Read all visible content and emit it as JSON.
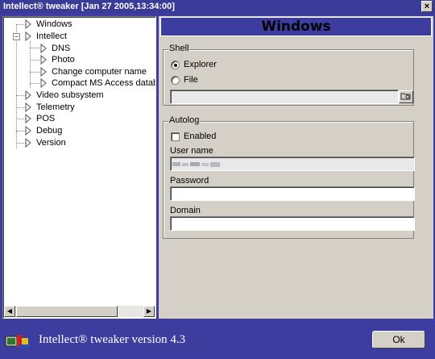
{
  "window": {
    "title": "Intellect® tweaker [Jan 27 2005,13:34:00]",
    "close_glyph": "×"
  },
  "tree": {
    "expander_glyph": "−",
    "nodes": [
      {
        "label": "Windows",
        "level": 0
      },
      {
        "label": "Intellect",
        "level": 0,
        "expanded": true
      },
      {
        "label": "DNS",
        "level": 1
      },
      {
        "label": "Photo",
        "level": 1
      },
      {
        "label": "Change computer name",
        "level": 1
      },
      {
        "label": "Compact MS Access database",
        "level": 1
      },
      {
        "label": "Video subsystem",
        "level": 0
      },
      {
        "label": "Telemetry",
        "level": 0
      },
      {
        "label": "POS",
        "level": 0
      },
      {
        "label": "Debug",
        "level": 0
      },
      {
        "label": "Version",
        "level": 0
      }
    ],
    "scroll_left_glyph": "◀",
    "scroll_right_glyph": "▶"
  },
  "panel": {
    "title": "Windows",
    "shell": {
      "group_title": "Shell",
      "option_explorer": "Explorer",
      "option_file": "File",
      "selected": "Explorer",
      "file_path": "",
      "browse_icon": "folder-search-icon"
    },
    "autolog": {
      "group_title": "Autolog",
      "enabled_label": "Enabled",
      "enabled": false,
      "user_name_label": "User name",
      "user_name_value": "",
      "password_label": "Password",
      "password_value": "",
      "domain_label": "Domain",
      "domain_value": ""
    }
  },
  "footer": {
    "version_text": "Intellect® tweaker version 4.3",
    "ok_label": "Ok",
    "logo_icon": "app-logo-icon"
  },
  "colors": {
    "accent": "#3d3d9f",
    "face": "#d4d0c8"
  }
}
